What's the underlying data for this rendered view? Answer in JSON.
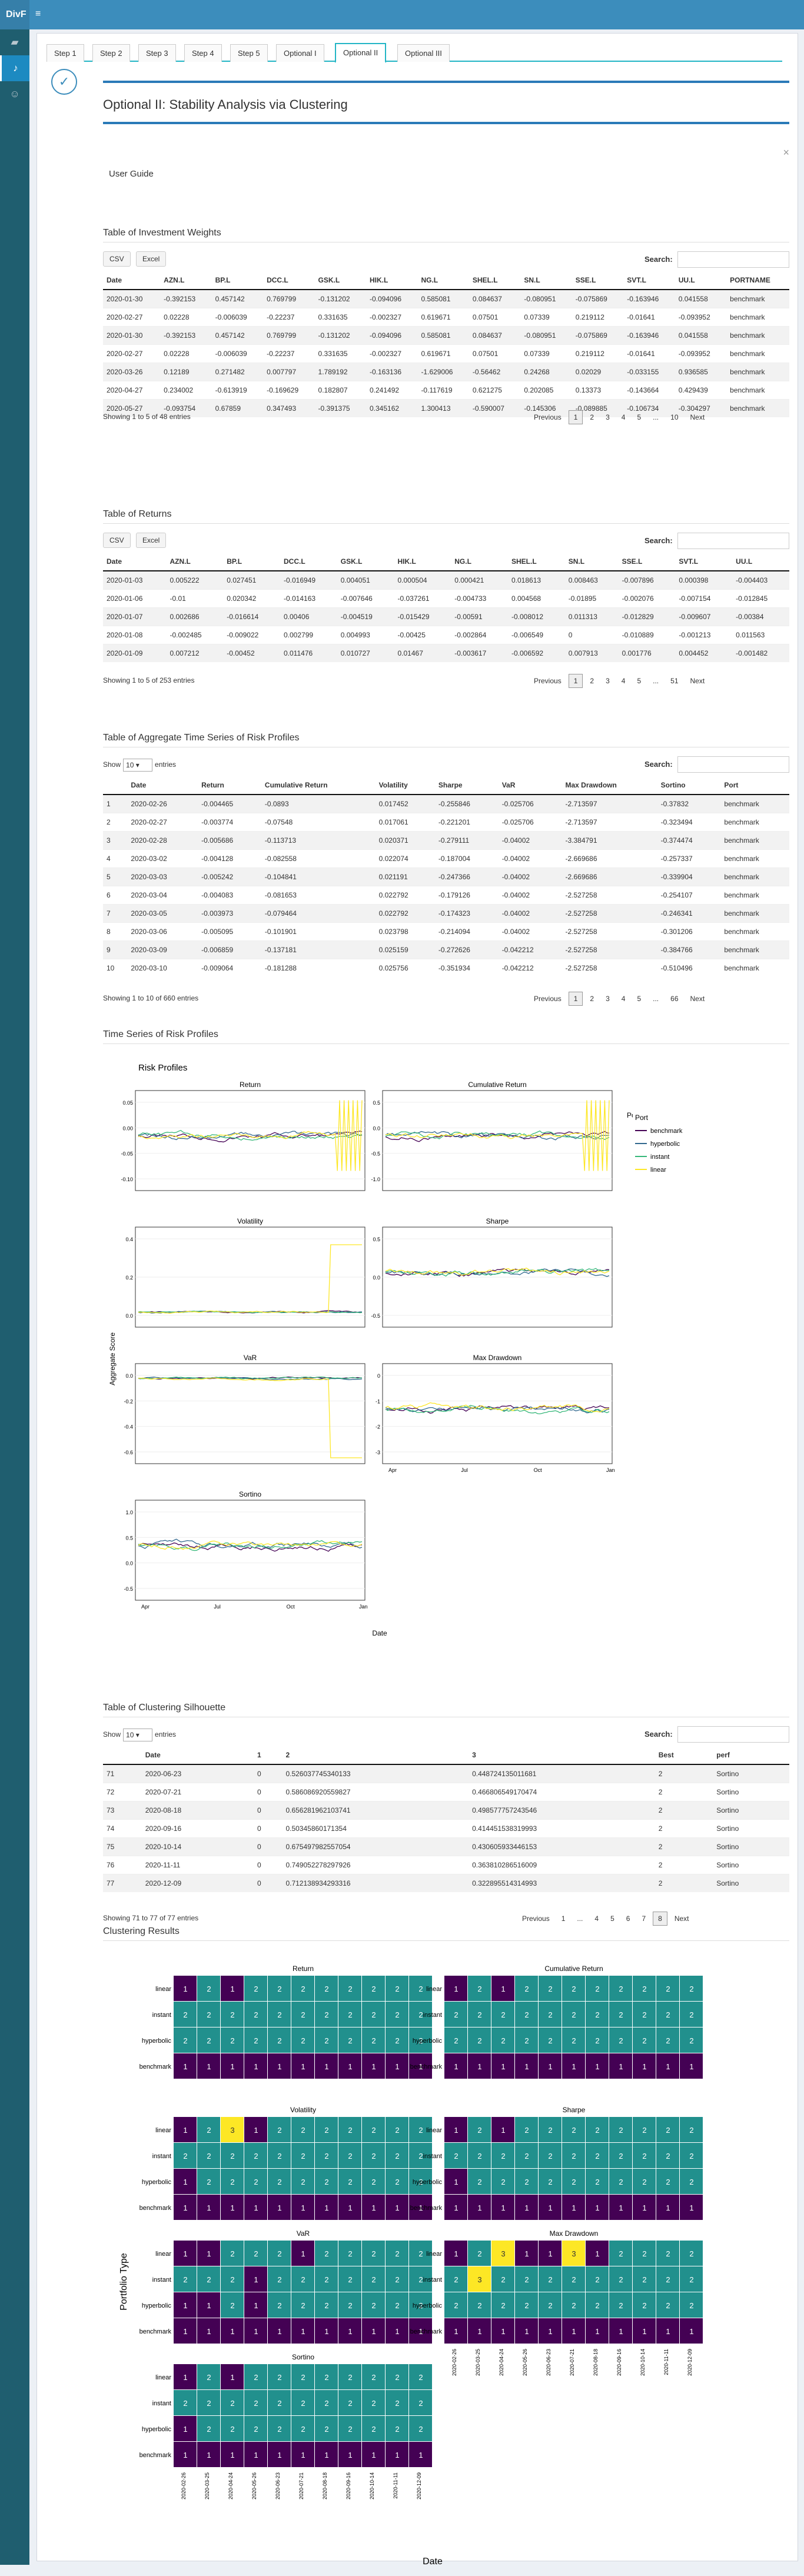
{
  "app": {
    "brand": "DivF",
    "toggle": "≡"
  },
  "sidebar": {
    "items": [
      {
        "icon": "folder-icon"
      },
      {
        "icon": "bell-icon"
      },
      {
        "icon": "user-icon"
      }
    ]
  },
  "tabs": [
    "Step 1",
    "Step 2",
    "Step 3",
    "Step 4",
    "Step 5",
    "Optional I",
    "Optional II",
    "Optional III"
  ],
  "page": {
    "title": "Optional II: Stability Analysis via Clustering",
    "user_guide": "User Guide",
    "close": "×"
  },
  "common": {
    "csv": "CSV",
    "excel": "Excel",
    "search": "Search:",
    "previous": "Previous",
    "next": "Next",
    "show": "Show",
    "entries": "entries",
    "show_val": "10"
  },
  "weights": {
    "title": "Table of Investment Weights",
    "headers": [
      "Date",
      "AZN.L",
      "BP.L",
      "DCC.L",
      "GSK.L",
      "HIK.L",
      "NG.L",
      "SHEL.L",
      "SN.L",
      "SSE.L",
      "SVT.L",
      "UU.L",
      "PORTNAME"
    ],
    "rows": [
      [
        "2020-01-30",
        "-0.392153",
        "0.457142",
        "0.769799",
        "-0.131202",
        "-0.094096",
        "0.585081",
        "0.084637",
        "-0.080951",
        "-0.075869",
        "-0.163946",
        "0.041558",
        "benchmark"
      ],
      [
        "2020-02-27",
        "0.02228",
        "-0.006039",
        "-0.22237",
        "0.331635",
        "-0.002327",
        "0.619671",
        "0.07501",
        "0.07339",
        "0.219112",
        "-0.01641",
        "-0.093952",
        "benchmark"
      ],
      [
        "2020-01-30",
        "-0.392153",
        "0.457142",
        "0.769799",
        "-0.131202",
        "-0.094096",
        "0.585081",
        "0.084637",
        "-0.080951",
        "-0.075869",
        "-0.163946",
        "0.041558",
        "benchmark"
      ],
      [
        "2020-02-27",
        "0.02228",
        "-0.006039",
        "-0.22237",
        "0.331635",
        "-0.002327",
        "0.619671",
        "0.07501",
        "0.07339",
        "0.219112",
        "-0.01641",
        "-0.093952",
        "benchmark"
      ],
      [
        "2020-03-26",
        "0.12189",
        "0.271482",
        "0.007797",
        "1.789192",
        "-0.163136",
        "-1.629006",
        "-0.56462",
        "0.24268",
        "0.02029",
        "-0.033155",
        "0.936585",
        "benchmark"
      ],
      [
        "2020-04-27",
        "0.234002",
        "-0.613919",
        "-0.169629",
        "0.182807",
        "0.241492",
        "-0.117619",
        "0.621275",
        "0.202085",
        "0.13373",
        "-0.143664",
        "0.429439",
        "benchmark"
      ],
      [
        "2020-05-27",
        "-0.093754",
        "0.67859",
        "0.347493",
        "-0.391375",
        "0.345162",
        "1.300413",
        "-0.590007",
        "-0.145306",
        "-0.089885",
        "-0.106734",
        "-0.304297",
        "benchmark"
      ]
    ],
    "info": "Showing 1 to 5 of 48 entries",
    "pages": [
      "1",
      "2",
      "3",
      "4",
      "5",
      "...",
      "10"
    ]
  },
  "returns": {
    "title": "Table of Returns",
    "headers": [
      "Date",
      "AZN.L",
      "BP.L",
      "DCC.L",
      "GSK.L",
      "HIK.L",
      "NG.L",
      "SHEL.L",
      "SN.L",
      "SSE.L",
      "SVT.L",
      "UU.L"
    ],
    "rows": [
      [
        "2020-01-03",
        "0.005222",
        "0.027451",
        "-0.016949",
        "0.004051",
        "0.000504",
        "0.000421",
        "0.018613",
        "0.008463",
        "-0.007896",
        "0.000398",
        "-0.004403"
      ],
      [
        "2020-01-06",
        "-0.01",
        "0.020342",
        "-0.014163",
        "-0.007646",
        "-0.037261",
        "-0.004733",
        "0.004568",
        "-0.01895",
        "-0.002076",
        "-0.007154",
        "-0.012845"
      ],
      [
        "2020-01-07",
        "0.002686",
        "-0.016614",
        "0.00406",
        "-0.004519",
        "-0.015429",
        "-0.00591",
        "-0.008012",
        "0.011313",
        "-0.012829",
        "-0.009607",
        "-0.00384"
      ],
      [
        "2020-01-08",
        "-0.002485",
        "-0.009022",
        "0.002799",
        "0.004993",
        "-0.00425",
        "-0.002864",
        "-0.006549",
        "0",
        "-0.010889",
        "-0.001213",
        "0.011563"
      ],
      [
        "2020-01-09",
        "0.007212",
        "-0.00452",
        "0.011476",
        "0.010727",
        "0.01467",
        "-0.003617",
        "-0.006592",
        "0.007913",
        "0.001776",
        "0.004452",
        "-0.001482"
      ]
    ],
    "info": "Showing 1 to 5 of 253 entries",
    "pages": [
      "1",
      "2",
      "3",
      "4",
      "5",
      "...",
      "51"
    ]
  },
  "aggregate": {
    "title": "Table of Aggregate Time Series of Risk Profiles",
    "headers": [
      "",
      "Date",
      "Return",
      "Cumulative Return",
      "Volatility",
      "Sharpe",
      "VaR",
      "Max Drawdown",
      "Sortino",
      "Port"
    ],
    "rows": [
      [
        "1",
        "2020-02-26",
        "-0.004465",
        "-0.0893",
        "0.017452",
        "-0.255846",
        "-0.025706",
        "-2.713597",
        "-0.37832",
        "benchmark"
      ],
      [
        "2",
        "2020-02-27",
        "-0.003774",
        "-0.07548",
        "0.017061",
        "-0.221201",
        "-0.025706",
        "-2.713597",
        "-0.323494",
        "benchmark"
      ],
      [
        "3",
        "2020-02-28",
        "-0.005686",
        "-0.113713",
        "0.020371",
        "-0.279111",
        "-0.04002",
        "-3.384791",
        "-0.374474",
        "benchmark"
      ],
      [
        "4",
        "2020-03-02",
        "-0.004128",
        "-0.082558",
        "0.022074",
        "-0.187004",
        "-0.04002",
        "-2.669686",
        "-0.257337",
        "benchmark"
      ],
      [
        "5",
        "2020-03-03",
        "-0.005242",
        "-0.104841",
        "0.021191",
        "-0.247366",
        "-0.04002",
        "-2.669686",
        "-0.339904",
        "benchmark"
      ],
      [
        "6",
        "2020-03-04",
        "-0.004083",
        "-0.081653",
        "0.022792",
        "-0.179126",
        "-0.04002",
        "-2.527258",
        "-0.254107",
        "benchmark"
      ],
      [
        "7",
        "2020-03-05",
        "-0.003973",
        "-0.079464",
        "0.022792",
        "-0.174323",
        "-0.04002",
        "-2.527258",
        "-0.246341",
        "benchmark"
      ],
      [
        "8",
        "2020-03-06",
        "-0.005095",
        "-0.101901",
        "0.023798",
        "-0.214094",
        "-0.04002",
        "-2.527258",
        "-0.301206",
        "benchmark"
      ],
      [
        "9",
        "2020-03-09",
        "-0.006859",
        "-0.137181",
        "0.025159",
        "-0.272626",
        "-0.042212",
        "-2.527258",
        "-0.384766",
        "benchmark"
      ],
      [
        "10",
        "2020-03-10",
        "-0.009064",
        "-0.181288",
        "0.025756",
        "-0.351934",
        "-0.042212",
        "-2.527258",
        "-0.510496",
        "benchmark"
      ]
    ],
    "info": "Showing 1 to 10 of 660 entries",
    "pages": [
      "1",
      "2",
      "3",
      "4",
      "5",
      "...",
      "66"
    ]
  },
  "ts_title": "Time Series of Risk Profiles",
  "silhouette": {
    "title": "Table of Clustering Silhouette",
    "headers": [
      "",
      "Date",
      "1",
      "2",
      "3",
      "Best",
      "perf"
    ],
    "rows": [
      [
        "71",
        "2020-06-23",
        "0",
        "0.526037745340133",
        "0.448724135011681",
        "2",
        "Sortino"
      ],
      [
        "72",
        "2020-07-21",
        "0",
        "0.586086920559827",
        "0.466806549170474",
        "2",
        "Sortino"
      ],
      [
        "73",
        "2020-08-18",
        "0",
        "0.656281962103741",
        "0.498577757243546",
        "2",
        "Sortino"
      ],
      [
        "74",
        "2020-09-16",
        "0",
        "0.50345860171354",
        "0.414451538319993",
        "2",
        "Sortino"
      ],
      [
        "75",
        "2020-10-14",
        "0",
        "0.675497982557054",
        "0.430605933446153",
        "2",
        "Sortino"
      ],
      [
        "76",
        "2020-11-11",
        "0",
        "0.749052278297926",
        "0.363810286516009",
        "2",
        "Sortino"
      ],
      [
        "77",
        "2020-12-09",
        "0",
        "0.712138934293316",
        "0.322895514314993",
        "2",
        "Sortino"
      ]
    ],
    "info": "Showing 71 to 77 of 77 entries",
    "pages": [
      "1",
      "...",
      "4",
      "5",
      "6",
      "7",
      "8"
    ]
  },
  "clust_title": "Clustering Results",
  "chart_data": [
    {
      "type": "line",
      "title": "Risk Profiles",
      "panels": [
        "Return",
        "Cumulative Return",
        "Volatility",
        "Sharpe",
        "VaR",
        "Max Drawdown",
        "Sortino"
      ],
      "ylabel": "Aggregate Score",
      "xlabel": "Date",
      "x_ticks": [
        "Apr",
        "Jul",
        "Oct",
        "Jan"
      ],
      "legend_title": "Port",
      "series": [
        {
          "name": "benchmark",
          "color": "#440154"
        },
        {
          "name": "hyperbolic",
          "color": "#31688e"
        },
        {
          "name": "instant",
          "color": "#35b779"
        },
        {
          "name": "linear",
          "color": "#fde725"
        }
      ],
      "y_ticks": {
        "Return": [
          "0.05",
          "0.00",
          "-0.05",
          "-0.10"
        ],
        "Cumulative Return": [
          "0.5",
          "0.0",
          "-0.5",
          "-1.0"
        ],
        "Volatility": [
          "0.4",
          "0.2",
          "0.0"
        ],
        "Sharpe": [
          "0.5",
          "0.0",
          "-0.5"
        ],
        "VaR": [
          "0.0",
          "-0.2",
          "-0.4",
          "-0.6"
        ],
        "Max Drawdown": [
          "0",
          "-1",
          "-2",
          "-3"
        ],
        "Sortino": [
          "1.0",
          "0.5",
          "0.0",
          "-0.5"
        ]
      }
    },
    {
      "type": "heatmap",
      "panels": [
        "Return",
        "Cumulative Return",
        "Volatility",
        "Sharpe",
        "VaR",
        "Max Drawdown",
        "Sortino"
      ],
      "rows": [
        "linear",
        "instant",
        "hyperbolic",
        "benchmark"
      ],
      "ylabel": "Portfolio Type",
      "xlabel": "Date",
      "dates": [
        "2020-02-26",
        "2020-03-25",
        "2020-04-24",
        "2020-05-26",
        "2020-06-23",
        "2020-07-21",
        "2020-08-18",
        "2020-09-16",
        "2020-10-14",
        "2020-11-11",
        "2020-12-09"
      ],
      "values": {
        "Return": [
          [
            1,
            2,
            1,
            2,
            2,
            2,
            2,
            2,
            2,
            2,
            2
          ],
          [
            2,
            2,
            2,
            2,
            2,
            2,
            2,
            2,
            2,
            2,
            2
          ],
          [
            2,
            2,
            2,
            2,
            2,
            2,
            2,
            2,
            2,
            2,
            2
          ],
          [
            1,
            1,
            1,
            1,
            1,
            1,
            1,
            1,
            1,
            1,
            1
          ]
        ],
        "Cumulative Return": [
          [
            1,
            2,
            1,
            2,
            2,
            2,
            2,
            2,
            2,
            2,
            2
          ],
          [
            2,
            2,
            2,
            2,
            2,
            2,
            2,
            2,
            2,
            2,
            2
          ],
          [
            2,
            2,
            2,
            2,
            2,
            2,
            2,
            2,
            2,
            2,
            2
          ],
          [
            1,
            1,
            1,
            1,
            1,
            1,
            1,
            1,
            1,
            1,
            1
          ]
        ],
        "Volatility": [
          [
            1,
            2,
            3,
            1,
            2,
            2,
            2,
            2,
            2,
            2,
            2
          ],
          [
            2,
            2,
            2,
            2,
            2,
            2,
            2,
            2,
            2,
            2,
            2
          ],
          [
            1,
            2,
            2,
            2,
            2,
            2,
            2,
            2,
            2,
            2,
            2
          ],
          [
            1,
            1,
            1,
            1,
            1,
            1,
            1,
            1,
            1,
            1,
            1
          ]
        ],
        "Sharpe": [
          [
            1,
            2,
            1,
            2,
            2,
            2,
            2,
            2,
            2,
            2,
            2
          ],
          [
            2,
            2,
            2,
            2,
            2,
            2,
            2,
            2,
            2,
            2,
            2
          ],
          [
            1,
            2,
            2,
            2,
            2,
            2,
            2,
            2,
            2,
            2,
            2
          ],
          [
            1,
            1,
            1,
            1,
            1,
            1,
            1,
            1,
            1,
            1,
            1
          ]
        ],
        "VaR": [
          [
            1,
            1,
            2,
            2,
            2,
            1,
            2,
            2,
            2,
            2,
            2
          ],
          [
            2,
            2,
            2,
            1,
            2,
            2,
            2,
            2,
            2,
            2,
            2
          ],
          [
            1,
            1,
            2,
            1,
            2,
            2,
            2,
            2,
            2,
            2,
            2
          ],
          [
            1,
            1,
            1,
            1,
            1,
            1,
            1,
            1,
            1,
            1,
            1
          ]
        ],
        "Max Drawdown": [
          [
            1,
            2,
            3,
            1,
            1,
            3,
            1,
            2,
            2,
            2,
            2
          ],
          [
            2,
            3,
            2,
            2,
            2,
            2,
            2,
            2,
            2,
            2,
            2
          ],
          [
            2,
            2,
            2,
            2,
            2,
            2,
            2,
            2,
            2,
            2,
            2
          ],
          [
            1,
            1,
            1,
            1,
            1,
            1,
            1,
            1,
            1,
            1,
            1
          ]
        ],
        "Sortino": [
          [
            1,
            2,
            1,
            2,
            2,
            2,
            2,
            2,
            2,
            2,
            2
          ],
          [
            2,
            2,
            2,
            2,
            2,
            2,
            2,
            2,
            2,
            2,
            2
          ],
          [
            1,
            2,
            2,
            2,
            2,
            2,
            2,
            2,
            2,
            2,
            2
          ],
          [
            1,
            1,
            1,
            1,
            1,
            1,
            1,
            1,
            1,
            1,
            1
          ]
        ]
      },
      "colors": {
        "1": "#440154",
        "2": "#21908d",
        "3": "#fde725"
      }
    }
  ]
}
